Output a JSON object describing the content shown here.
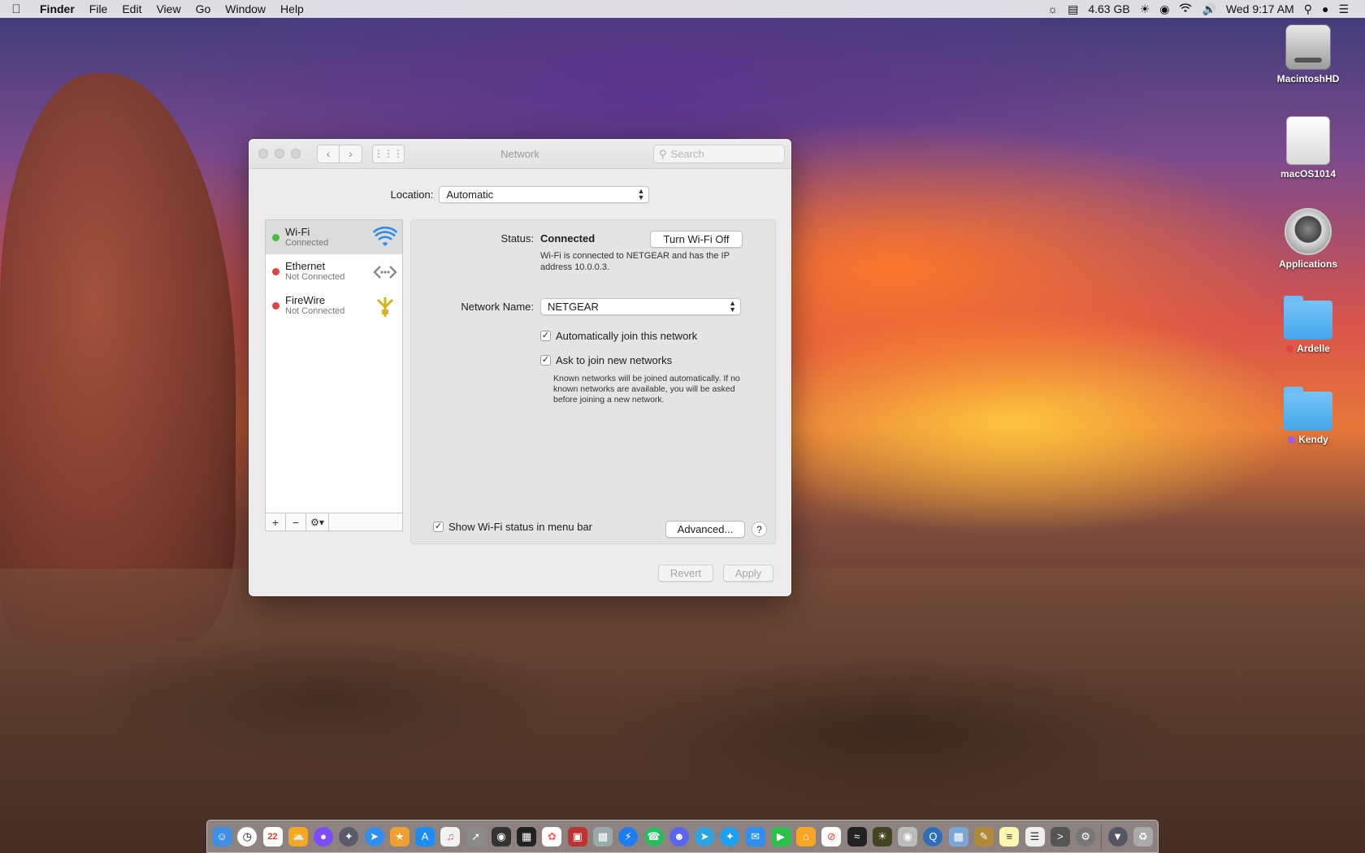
{
  "menubar": {
    "apple_icon": "apple-logo-icon",
    "items": [
      "Finder",
      "File",
      "Edit",
      "View",
      "Go",
      "Window",
      "Help"
    ],
    "memory": "4.63 GB",
    "clock": "Wed 9:17 AM"
  },
  "desktop_icons": [
    {
      "label": "MacintoshHD",
      "icon": "hard-drive-icon"
    },
    {
      "label": "macOS1014",
      "icon": "disk-image-icon"
    },
    {
      "label": "Applications",
      "icon": "applications-folder-icon"
    },
    {
      "label": "Ardelle",
      "icon": "folder-icon",
      "tag_color": "#e0443e"
    },
    {
      "label": "Kendy",
      "icon": "folder-icon",
      "tag_color": "#a15ae6"
    }
  ],
  "window": {
    "title": "Network",
    "search_placeholder": "Search",
    "location_label": "Location:",
    "location_value": "Automatic",
    "services": [
      {
        "name": "Wi-Fi",
        "status": "Connected",
        "status_color": "#3ec13f",
        "icon": "wifi-icon"
      },
      {
        "name": "Ethernet",
        "status": "Not Connected",
        "status_color": "#e0443e",
        "icon": "ethernet-icon"
      },
      {
        "name": "FireWire",
        "status": "Not Connected",
        "status_color": "#e0443e",
        "icon": "firewire-icon"
      }
    ],
    "detail": {
      "status_label": "Status:",
      "status_value": "Connected",
      "turn_off_button": "Turn Wi-Fi Off",
      "status_description": "Wi-Fi is connected to NETGEAR and has the IP address 10.0.0.3.",
      "network_name_label": "Network Name:",
      "network_name_value": "NETGEAR",
      "auto_join_label": "Automatically join this network",
      "ask_join_label": "Ask to join new networks",
      "ask_join_note": "Known networks will be joined automatically. If no known networks are available, you will be asked before joining a new network.",
      "show_status_label": "Show Wi-Fi status in menu bar",
      "advanced_button": "Advanced...",
      "help_button": "?"
    },
    "revert_button": "Revert",
    "apply_button": "Apply"
  },
  "dock": {
    "calendar_day": "22",
    "apps": [
      "finder-icon",
      "clock-icon",
      "calendar-icon",
      "weather-icon",
      "siri-icon",
      "launchpad-icon",
      "safari-icon",
      "fantastical-icon",
      "app-store-icon",
      "music-icon",
      "rocket-icon",
      "activity-icon",
      "grid-app-icon",
      "photos-icon",
      "photo-booth-icon",
      "preview-icon",
      "messenger-icon",
      "whatsapp-icon",
      "discord-icon",
      "telegram-icon",
      "twitter-icon",
      "messages-icon",
      "facetime-icon",
      "home-icon",
      "news-icon",
      "stocks-icon",
      "photo-app-icon",
      "disk-utility-icon",
      "quicktime-icon",
      "preview-2-icon",
      "notes-icon",
      "textedit-icon",
      "script-editor-icon",
      "terminal-icon",
      "system-preferences-icon",
      "downloads-icon",
      "trash-icon"
    ]
  }
}
